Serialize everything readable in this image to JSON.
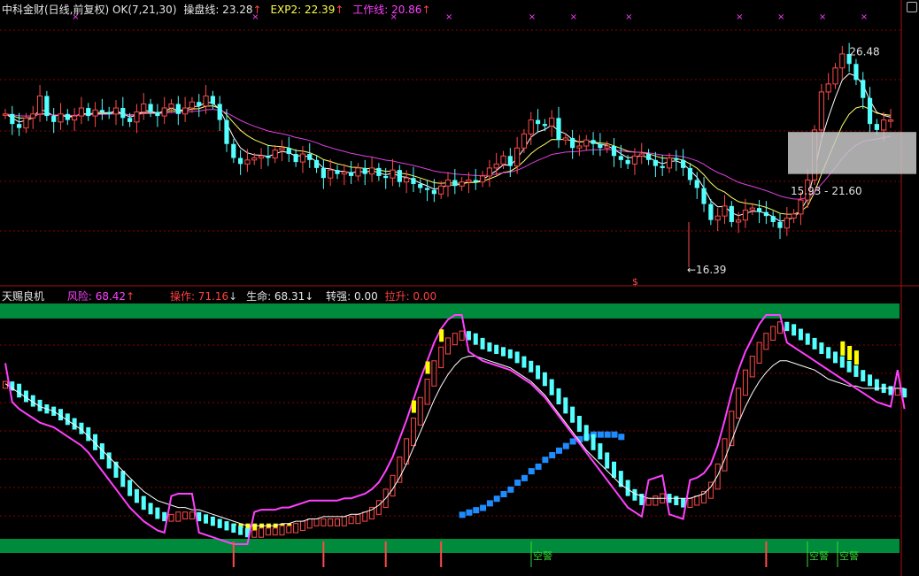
{
  "top_header": {
    "title": "中科金财(日线,前复权)",
    "ok_label": "OK(7,21,30)",
    "caopan_label": "操盘线: 23.28",
    "exp2_label": "EXP2: 22.39",
    "work_label": "工作线: 20.86",
    "up_arrow": "↑"
  },
  "bottom_header": {
    "title": "天赐良机",
    "risk_label": "风险: 68.42",
    "risk_arrow": "↑",
    "op_label": "操作: 71.16",
    "op_arrow": "↓",
    "life_label": "生命: 68.31",
    "life_arrow": "↓",
    "strong_label": "转强: 0.00",
    "lift_label": "拉升: 0.00"
  },
  "annotations": {
    "high_label": "26.48",
    "low_label": "←16.39",
    "range_label": "15.93 - 21.60",
    "s_marker": "$",
    "kong_label": "空警",
    "x_marker": "×"
  },
  "colors": {
    "up": "#ff4a4a",
    "down": "#54ffff",
    "ma_fast": "#ffffff",
    "ma_mid": "#ffff66",
    "ma_slow": "#e040e0",
    "band": "#008a3c",
    "blue": "#1e8cff",
    "yellow": "#ffff00",
    "magenta": "#ff40ff",
    "grid": "#8a0000"
  },
  "chart_data": [
    {
      "type": "candlestick",
      "title": "中科金财(日线,前复权)",
      "ylim": [
        15.5,
        28.5
      ],
      "series": [
        {
          "name": "操盘线",
          "last": 23.28
        },
        {
          "name": "EXP2",
          "last": 22.39
        },
        {
          "name": "工作线",
          "last": 20.86
        }
      ],
      "close": [
        23.6,
        23.1,
        22.9,
        23.4,
        23.6,
        24.5,
        23.5,
        23.2,
        23.6,
        23.3,
        23.5,
        23.9,
        23.5,
        23.8,
        23.7,
        23.6,
        23.9,
        23.4,
        23.2,
        23.7,
        24.1,
        23.7,
        23.5,
        23.9,
        24.1,
        23.6,
        23.9,
        24.2,
        24.0,
        24.5,
        24.1,
        23.3,
        22.1,
        21.4,
        21.1,
        21.3,
        21.4,
        21.5,
        21.4,
        21.8,
        21.9,
        21.6,
        21.2,
        21.6,
        21.3,
        20.9,
        20.4,
        20.8,
        20.6,
        20.7,
        20.5,
        20.9,
        20.6,
        20.9,
        20.5,
        20.4,
        20.8,
        20.2,
        20.4,
        20.1,
        19.9,
        19.8,
        19.6,
        20.0,
        20.3,
        20.0,
        20.2,
        20.3,
        20.2,
        20.5,
        20.9,
        21.1,
        21.5,
        21.0,
        21.9,
        22.6,
        23.3,
        23.1,
        23.0,
        23.4,
        22.3,
        22.4,
        21.9,
        22.0,
        22.3,
        22.1,
        21.9,
        22.0,
        21.5,
        21.3,
        21.1,
        21.5,
        21.6,
        21.3,
        21.0,
        20.9,
        21.4,
        21.3,
        20.9,
        20.3,
        19.9,
        19.1,
        18.3,
        18.5,
        19.0,
        18.2,
        18.3,
        18.8,
        18.9,
        18.7,
        18.5,
        18.2,
        17.9,
        18.4,
        18.6,
        19.3,
        20.3,
        22.8,
        24.7,
        25.1,
        25.9,
        26.6,
        26.1,
        25.3,
        24.4,
        23.1,
        22.8,
        23.3,
        23.3
      ],
      "high_label": 26.48,
      "low_label": 16.39,
      "range": [
        15.93,
        21.6
      ]
    },
    {
      "type": "indicator",
      "title": "天赐良机",
      "ylim": [
        0,
        100
      ],
      "series": [
        {
          "name": "风险",
          "last": 68.42
        },
        {
          "name": "操作",
          "last": 71.16
        },
        {
          "name": "生命",
          "last": 68.31
        },
        {
          "name": "转强",
          "last": 0.0
        },
        {
          "name": "拉升",
          "last": 0.0
        }
      ],
      "risk": [
        71,
        70,
        67,
        65,
        63,
        61,
        60,
        59,
        57,
        55,
        53,
        51,
        48,
        44,
        40,
        36,
        32,
        28,
        24,
        21,
        18,
        16,
        14,
        13,
        13,
        14,
        14,
        14,
        13,
        12,
        11,
        10,
        9,
        8,
        7,
        6,
        6,
        7,
        7,
        7,
        8,
        8,
        9,
        10,
        11,
        11,
        11,
        11,
        11,
        12,
        12,
        13,
        14,
        16,
        19,
        24,
        30,
        38,
        46,
        55,
        64,
        72,
        80,
        86,
        90,
        92,
        93,
        92,
        90,
        88,
        87,
        86,
        85,
        84,
        82,
        80,
        78,
        75,
        72,
        68,
        64,
        60,
        56,
        52,
        48,
        44,
        40,
        36,
        32,
        28,
        24,
        22,
        20,
        20,
        21,
        22,
        21,
        20,
        19,
        20,
        21,
        23,
        27,
        35,
        46,
        58,
        68,
        76,
        82,
        88,
        92,
        95,
        97,
        96,
        94,
        92,
        90,
        88,
        86,
        84,
        82,
        80,
        78,
        76,
        74,
        72,
        70,
        69,
        68,
        68,
        67
      ],
      "white_line": [
        70,
        68,
        66,
        64,
        62,
        60,
        59,
        58,
        56,
        54,
        52,
        50,
        47,
        44,
        41,
        38,
        35,
        32,
        29,
        26,
        23,
        21,
        19,
        18,
        17,
        16,
        16,
        15,
        15,
        14,
        13,
        12,
        11,
        10,
        9,
        8,
        8,
        8,
        8,
        8,
        9,
        9,
        10,
        10,
        11,
        11,
        12,
        12,
        12,
        12,
        13,
        13,
        14,
        15,
        17,
        20,
        24,
        29,
        35,
        42,
        49,
        56,
        63,
        69,
        74,
        78,
        81,
        82,
        82,
        81,
        80,
        79,
        78,
        77,
        75,
        73,
        71,
        68,
        65,
        61,
        57,
        53,
        49,
        45,
        41,
        38,
        35,
        32,
        29,
        26,
        24,
        22,
        21,
        20,
        20,
        20,
        20,
        20,
        20,
        20,
        21,
        22,
        25,
        30,
        37,
        45,
        53,
        60,
        66,
        71,
        75,
        78,
        80,
        80,
        79,
        78,
        77,
        76,
        74,
        72,
        71,
        70,
        69,
        69,
        68,
        68,
        68,
        68,
        68,
        68,
        68
      ],
      "blue_line": [
        null,
        null,
        null,
        null,
        null,
        null,
        null,
        null,
        null,
        null,
        null,
        null,
        null,
        null,
        null,
        null,
        null,
        null,
        null,
        null,
        null,
        null,
        null,
        null,
        null,
        null,
        null,
        null,
        null,
        null,
        null,
        null,
        null,
        null,
        null,
        null,
        null,
        null,
        null,
        null,
        null,
        null,
        null,
        null,
        null,
        null,
        null,
        null,
        null,
        null,
        null,
        null,
        null,
        null,
        null,
        null,
        null,
        null,
        null,
        null,
        null,
        null,
        null,
        null,
        null,
        null,
        13,
        14,
        15,
        16,
        18,
        20,
        22,
        24,
        27,
        29,
        32,
        34,
        37,
        39,
        41,
        43,
        45,
        46,
        47,
        48,
        48,
        48,
        48,
        47,
        null,
        null,
        null,
        null,
        null,
        null,
        null,
        null,
        null,
        null,
        null,
        null,
        null,
        null,
        null,
        null,
        null,
        null,
        null,
        null,
        null,
        null,
        null,
        null,
        null,
        null,
        null,
        null,
        null,
        null,
        null,
        null,
        null,
        null,
        null,
        null,
        null,
        null,
        null,
        null,
        null
      ],
      "kong_jing_count": 3
    }
  ]
}
